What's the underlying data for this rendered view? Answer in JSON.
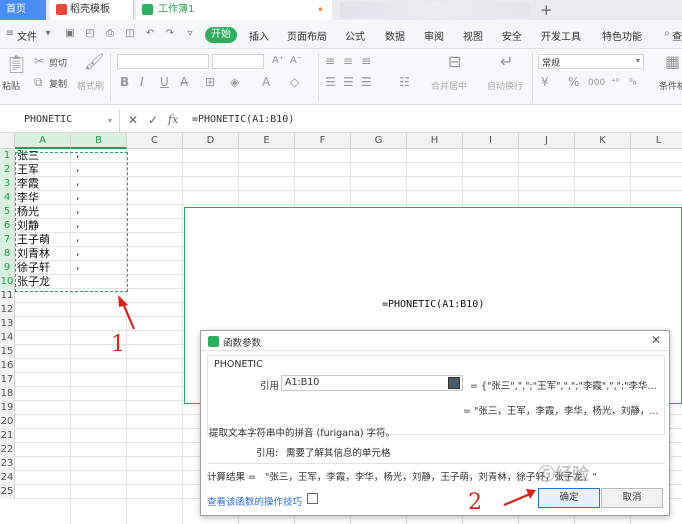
{
  "tabs": {
    "home": "首页",
    "template": "稻壳模板",
    "workbook": "工作簿1"
  },
  "menu": {
    "file": "文件",
    "start": "开始",
    "insert": "插入",
    "layout": "页面布局",
    "formula": "公式",
    "data": "数据",
    "review": "审阅",
    "view": "视图",
    "security": "安全",
    "dev": "开发工具",
    "special": "特色功能",
    "search": "查"
  },
  "ribbon": {
    "paste": "粘贴",
    "cut": "剪切",
    "copy": "复制",
    "format_painter": "格式刷",
    "merge_center": "合并居中",
    "wrap": "自动换行",
    "number_format": "常规",
    "cond_format": "条件格",
    "percent": "%",
    "thousands": "000"
  },
  "formula_bar": {
    "name_box": "PHONETIC",
    "fx": "fx",
    "formula": "=PHONETIC(A1:B10)"
  },
  "sheet": {
    "columns": [
      "A",
      "B",
      "C",
      "D",
      "E",
      "F",
      "G",
      "H",
      "I",
      "J",
      "K",
      "L"
    ],
    "rows": [
      "1",
      "2",
      "3",
      "4",
      "5",
      "6",
      "7",
      "8",
      "9",
      "10",
      "11",
      "12",
      "13",
      "14",
      "15",
      "16",
      "17",
      "18",
      "19",
      "20",
      "21",
      "22",
      "23",
      "24",
      "25"
    ],
    "colA": [
      "张三",
      "王军",
      "李霞",
      "李华",
      "杨光",
      "刘静",
      "王子萌",
      "刘青林",
      "徐子轩",
      "张子龙"
    ],
    "colB": [
      ",",
      ",",
      ",",
      ",",
      ",",
      ",",
      ",",
      ",",
      ",",
      ""
    ],
    "edit_formula": "=PHONETIC(A1:B10)"
  },
  "annotations": {
    "one": "1",
    "two": "2"
  },
  "dialog": {
    "title": "函数参数",
    "function_name": "PHONETIC",
    "ref_label": "引用",
    "ref_value": "A1:B10",
    "ref_result": "= {\"张三\",\",\";\"王军\",\",\";\"李霞\",\",\";\"李华...",
    "eval_result": "= \"张三，王军，李霞，李华，杨光，刘静，...",
    "description": "提取文本字符串中的拼音 (furigana) 字符。",
    "arg_help_label": "引用:",
    "arg_help": "需要了解其信息的单元格",
    "calc_label": "计算结果 =",
    "calc_result": "\"张三，王军，李霞，李华，杨光，刘静，王子萌，刘青林，徐子轩，张子龙，\"",
    "help_link": "查看该函数的操作技巧",
    "ok": "确定",
    "cancel": "取消"
  },
  "colors": {
    "accent_green": "#2fae60",
    "tab_blue": "#4b8cf5",
    "annotation_red": "#d9231f"
  }
}
